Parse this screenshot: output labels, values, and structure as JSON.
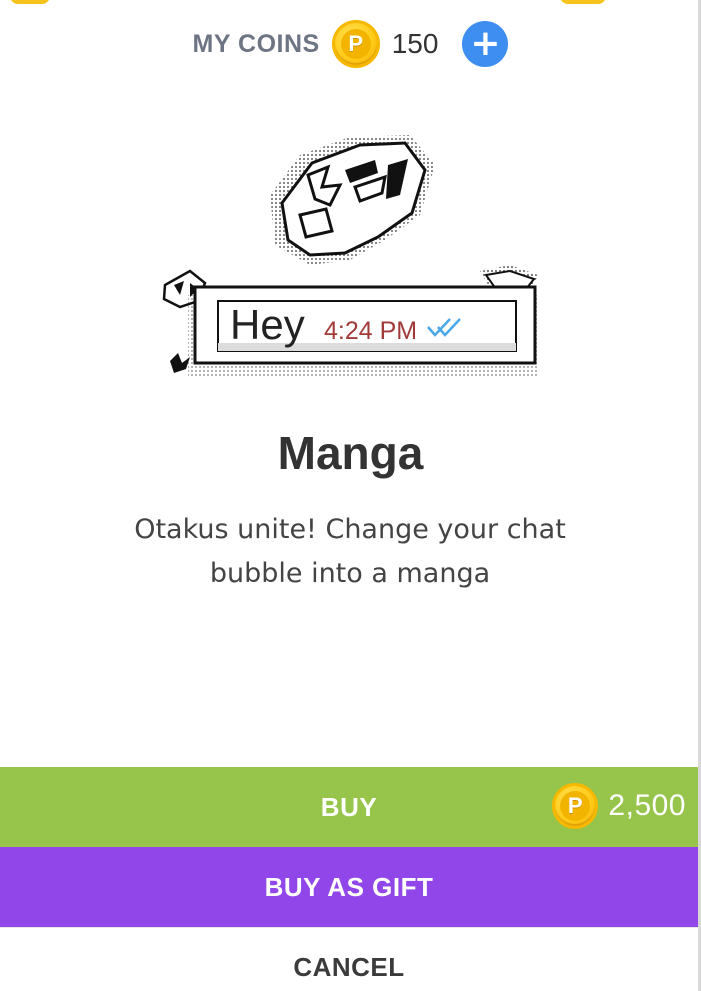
{
  "header": {
    "coins_label": "MY COINS",
    "coin_symbol": "P",
    "coins_value": "150",
    "add_coins_icon": "plus-icon",
    "add_coins_symbol": "+"
  },
  "preview": {
    "bubble_text": "Hey",
    "bubble_time": "4:24 PM",
    "read_status_icon": "double-check-icon"
  },
  "item": {
    "title": "Manga",
    "description": "Otakus unite! Change your chat bubble into a manga"
  },
  "actions": {
    "buy_label": "BUY",
    "price_coin_symbol": "P",
    "price_value": "2,500",
    "gift_label": "BUY AS GIFT",
    "cancel_label": "CANCEL"
  },
  "colors": {
    "buy": "#97c54b",
    "gift": "#9146ea",
    "plus": "#3d8ef0",
    "coin": "#ffcc1a",
    "time": "#a33a3a",
    "check": "#4aa8e8"
  }
}
